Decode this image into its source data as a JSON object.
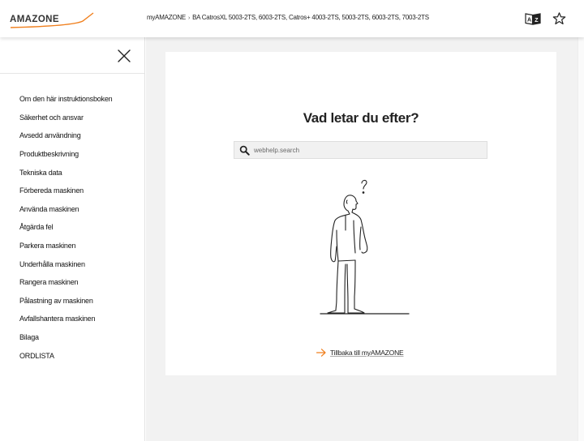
{
  "header": {
    "logo_text": "AMAZONE",
    "breadcrumb": {
      "home": "myAMAZONE",
      "current": "BA CatrosXL 5003-2TS, 6003-2TS, Catros+ 4003-2TS, 5003-2TS, 6003-2TS, 7003-2TS"
    },
    "icons": [
      "language-az-icon",
      "star-icon"
    ]
  },
  "sidebar": {
    "items": [
      {
        "label": "Om den här instruktionsboken"
      },
      {
        "label": "Säkerhet och ansvar"
      },
      {
        "label": "Avsedd användning"
      },
      {
        "label": "Produktbeskrivning"
      },
      {
        "label": "Tekniska data"
      },
      {
        "label": "Förbereda maskinen"
      },
      {
        "label": "Använda maskinen"
      },
      {
        "label": "Åtgärda fel"
      },
      {
        "label": "Parkera maskinen"
      },
      {
        "label": "Underhålla maskinen"
      },
      {
        "label": "Rangera maskinen"
      },
      {
        "label": "Pålastning av maskinen"
      },
      {
        "label": "Avfallshantera maskinen"
      },
      {
        "label": "Bilaga"
      },
      {
        "label": "ORDLISTA"
      }
    ]
  },
  "main": {
    "heading": "Vad letar du efter?",
    "search": {
      "placeholder": "webhelp.search",
      "value": ""
    },
    "back_link": "Tillbaka till myAMAZONE"
  },
  "colors": {
    "brand_orange": "#f07f1d",
    "panel_bg": "#f2f2f2"
  }
}
